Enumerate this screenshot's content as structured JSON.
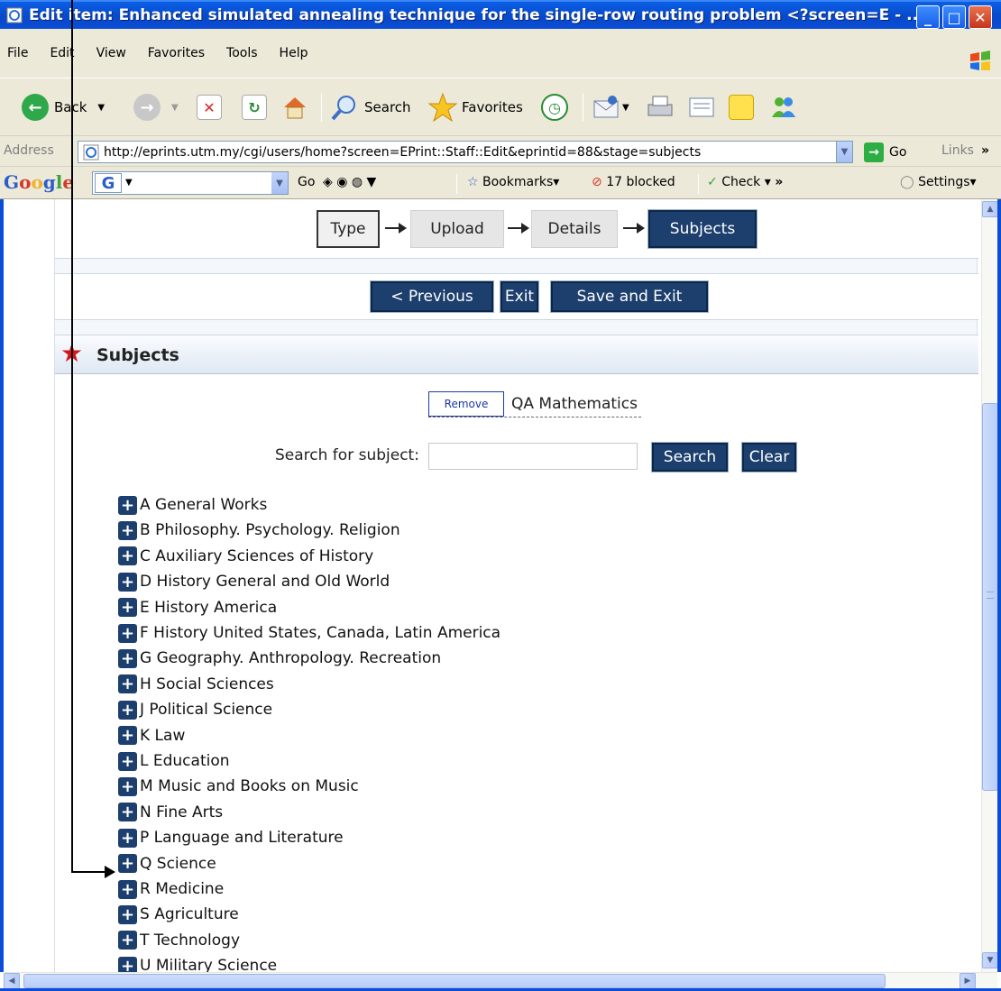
{
  "window": {
    "title": "Edit item: Enhanced simulated annealing technique for the single-row routing problem <?screen=E - ..."
  },
  "menu": [
    "File",
    "Edit",
    "View",
    "Favorites",
    "Tools",
    "Help"
  ],
  "toolbar": {
    "back": "Back",
    "search": "Search",
    "favorites": "Favorites"
  },
  "address": {
    "label": "Address",
    "url": "http://eprints.utm.my/cgi/users/home?screen=EPrint::Staff::Edit&eprintid=88&stage=subjects",
    "go": "Go",
    "links": "Links"
  },
  "googlebar": {
    "logo": "Google",
    "go": "Go",
    "bookmarks": "Bookmarks",
    "blocked": "17 blocked",
    "check": "Check",
    "settings": "Settings"
  },
  "stages": [
    "Type",
    "Upload",
    "Details",
    "Subjects"
  ],
  "nav": {
    "previous": "< Previous",
    "exit": "Exit",
    "save_exit": "Save and Exit"
  },
  "subjects": {
    "title": "Subjects",
    "remove": "Remove",
    "selected": "QA Mathematics",
    "search_label": "Search for subject:",
    "search_btn": "Search",
    "clear_btn": "Clear",
    "tree": [
      "A General Works",
      "B Philosophy. Psychology. Religion",
      "C Auxiliary Sciences of History",
      "D History General and Old World",
      "E History America",
      "F History United States, Canada, Latin America",
      "G Geography. Anthropology. Recreation",
      "H Social Sciences",
      "J Political Science",
      "K Law",
      "L Education",
      "M Music and Books on Music",
      "N Fine Arts",
      "P Language and Literature",
      "Q Science",
      "R Medicine",
      "S Agriculture",
      "T Technology",
      "U Military Science"
    ]
  },
  "colors": {
    "xp_blue": "#0a4dd6",
    "eprints_button": "#1c3f6e",
    "star": "#d4141c"
  }
}
